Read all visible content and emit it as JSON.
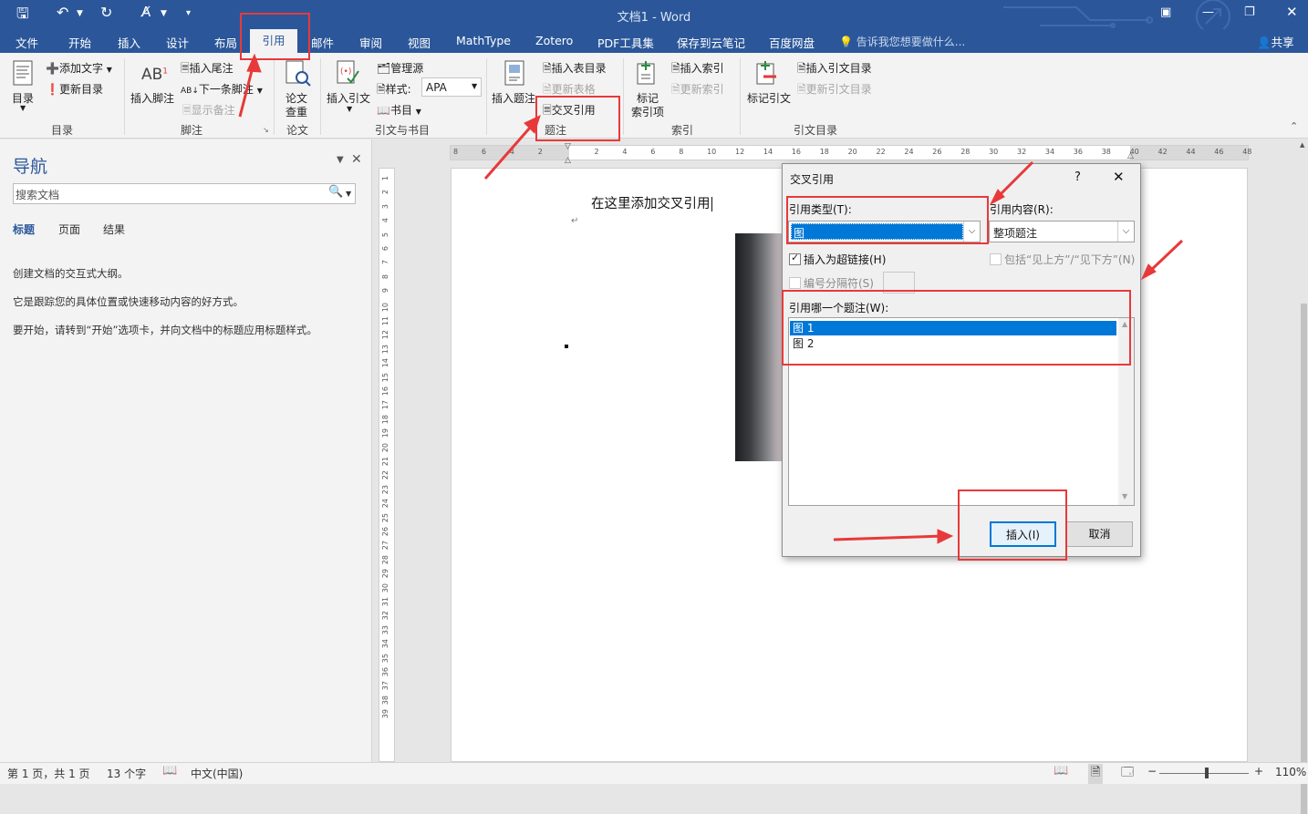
{
  "titlebar": {
    "title": "文档1 - Word"
  },
  "tabs": [
    "文件",
    "开始",
    "插入",
    "设计",
    "布局",
    "引用",
    "邮件",
    "审阅",
    "视图",
    "MathType",
    "Zotero",
    "PDF工具集",
    "保存到云笔记",
    "百度网盘"
  ],
  "tellme": "告诉我您想要做什么...",
  "share": "共享",
  "ribbon": {
    "toc": {
      "big": "目录",
      "add_text": "添加文字",
      "update": "更新目录",
      "group": "目录"
    },
    "footnote": {
      "insert_footnote": "插入脚注",
      "insert_endnote": "插入尾注",
      "next_footnote": "下一条脚注",
      "show_notes": "显示备注",
      "group": "脚注"
    },
    "paper": {
      "check": "论文\n查重",
      "check1": "论文",
      "check2": "查重",
      "group": "论文"
    },
    "citations": {
      "insert_citation": "插入引文",
      "manage_sources": "管理源",
      "style_label": "样式:",
      "style_value": "APA",
      "bibliography": "书目",
      "group": "引文与书目"
    },
    "captions": {
      "insert_caption": "插入题注",
      "insert_table_of_figures": "插入表目录",
      "update_table": "更新表格",
      "cross_reference": "交叉引用",
      "group": "题注"
    },
    "index": {
      "mark_entry1": "标记",
      "mark_entry2": "索引项",
      "insert_index": "插入索引",
      "update_index": "更新索引",
      "group": "索引"
    },
    "authorities": {
      "mark_citation": "标记引文",
      "insert_toa": "插入引文目录",
      "update_toa": "更新引文目录",
      "group": "引文目录"
    }
  },
  "nav": {
    "title": "导航",
    "search_placeholder": "搜索文档",
    "tabs": [
      "标题",
      "页面",
      "结果"
    ],
    "lines": [
      "创建文档的交互式大纲。",
      "它是跟踪您的具体位置或快速移动内容的好方式。",
      "要开始，请转到“开始”选项卡，并向文档中的标题应用标题样式。"
    ]
  },
  "ruler": {
    "h_ticks": [
      "8",
      "6",
      "4",
      "2",
      "",
      "2",
      "4",
      "6",
      "8",
      "10",
      "12",
      "14",
      "16",
      "18",
      "20",
      "22",
      "24",
      "26",
      "28",
      "30",
      "32",
      "34",
      "36",
      "38",
      "40",
      "42",
      "44",
      "46",
      "48"
    ],
    "v_ticks": [
      "1",
      "2",
      "3",
      "4",
      "5",
      "6",
      "7",
      "8",
      "9",
      "10",
      "11",
      "12",
      "13",
      "14",
      "15",
      "16",
      "17",
      "18",
      "19",
      "20",
      "21",
      "22",
      "23",
      "24",
      "25",
      "26",
      "27",
      "28",
      "29",
      "30",
      "31",
      "32",
      "33",
      "34",
      "35",
      "36",
      "37",
      "38",
      "39"
    ]
  },
  "document": {
    "text": "在这里添加交叉引用"
  },
  "dialog": {
    "title": "交叉引用",
    "help": "?",
    "ref_type_label": "引用类型(T):",
    "ref_type_value": "图",
    "ref_content_label": "引用内容(R):",
    "ref_content_value": "整项题注",
    "insert_hyperlink": "插入为超链接(H)",
    "include_above_below": "包括“见上方”/“见下方”(N)",
    "number_separator": "编号分隔符(S)",
    "which_caption_label": "引用哪一个题注(W):",
    "items": [
      "图 1",
      "图 2"
    ],
    "insert_button": "插入(I)",
    "cancel_button": "取消"
  },
  "status": {
    "page": "第 1 页，共 1 页",
    "words": "13 个字",
    "lang": "中文(中国)",
    "zoom": "110%"
  },
  "colors": {
    "accent": "#2b579a",
    "annotation": "#e8393a",
    "selection": "#0078d7"
  }
}
